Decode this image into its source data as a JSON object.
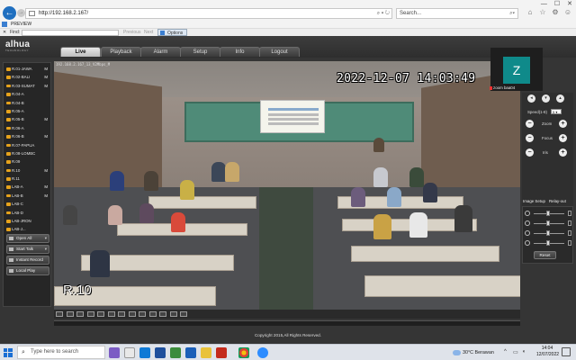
{
  "browser": {
    "address": "http://192.168.2.167/",
    "search_placeholder": "Search...",
    "tab_title": "PREVIEW",
    "find": {
      "close": "✕",
      "label": "Find:",
      "previous": "Previous",
      "next": "Next",
      "options": "Options"
    }
  },
  "app": {
    "logo": "alhua",
    "logo_tagline": "TECHNOLOGY",
    "menu": [
      "Live",
      "Playback",
      "Alarm",
      "Setup",
      "Info",
      "Logout"
    ],
    "active_menu": "Live"
  },
  "channels": [
    {
      "name": "R.01-JAWA",
      "flag": "M"
    },
    {
      "name": "R.02-BALI",
      "flag": "M"
    },
    {
      "name": "R.03-SUMAT",
      "flag": "M"
    },
    {
      "name": "R.04-A",
      "flag": ""
    },
    {
      "name": "R.04-B",
      "flag": ""
    },
    {
      "name": "R.05-A",
      "flag": ""
    },
    {
      "name": "R.05-B",
      "flag": "M"
    },
    {
      "name": "R.06-A",
      "flag": ""
    },
    {
      "name": "R.06-B",
      "flag": "M"
    },
    {
      "name": "R.07-PAPUA",
      "flag": ""
    },
    {
      "name": "R.08-LOMBC",
      "flag": ""
    },
    {
      "name": "R.09",
      "flag": ""
    },
    {
      "name": "R.10",
      "flag": "M"
    },
    {
      "name": "R.11",
      "flag": ""
    },
    {
      "name": "LAB-A",
      "flag": "M"
    },
    {
      "name": "LAB-B",
      "flag": "M"
    },
    {
      "name": "LAB-C",
      "flag": ""
    },
    {
      "name": "LAB-D",
      "flag": ""
    },
    {
      "name": "LAB-JRON",
      "flag": ""
    },
    {
      "name": "LAB-J...",
      "flag": ""
    }
  ],
  "side_buttons": [
    "Open All",
    "Start Talk",
    "Instant Record",
    "Local Play"
  ],
  "video": {
    "osd_info": "192.168.2.167_13_V2Mbps_M",
    "timestamp": "2022-12-07 14:03:49",
    "camera_name": "R.10"
  },
  "zoom": {
    "avatar_letter": "Z",
    "name": "zoom baa04"
  },
  "ptz": {
    "speed_label": "Speed(1-8)",
    "speed_value": "5",
    "zoom_label": "Zoom",
    "focus_label": "Focus",
    "iris_label": "Iris"
  },
  "image_setup": {
    "tab_image": "Image Setup",
    "tab_relay": "Relay-out",
    "reset": "Reset"
  },
  "copyright": "Copyright 2015,All Rights Reserved.",
  "taskbar": {
    "search_placeholder": "Type here to search",
    "weather": "30°C Berawan",
    "time": "14:04",
    "date": "12/07/2022"
  }
}
